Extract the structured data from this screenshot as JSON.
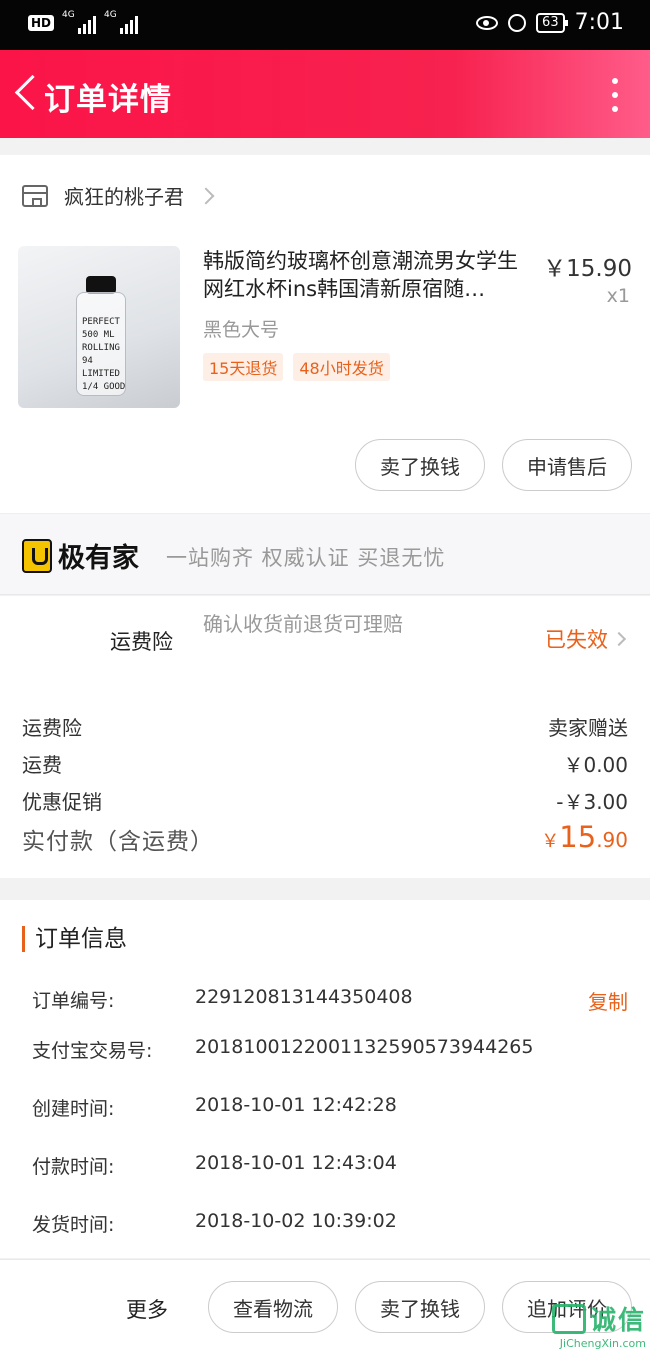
{
  "status_bar": {
    "hd_label": "HD",
    "net1": "4G",
    "net2": "4G",
    "battery": "63",
    "time": "7:01"
  },
  "nav": {
    "title": "订单详情"
  },
  "shop": {
    "name": "疯狂的桃子君"
  },
  "product": {
    "title": "韩版简约玻璃杯创意潮流男女学生网红水杯ins韩国清新原宿随…",
    "price": "￥15.90",
    "quantity": "x1",
    "spec": "黑色大号",
    "tags": [
      "15天退货",
      "48小时发货"
    ],
    "image_text": "PERFECT 500 ML ROLLING 94 LIMITED 1/4 GOOD"
  },
  "product_actions": {
    "sell_label": "卖了换钱",
    "aftersale_label": "申请售后"
  },
  "brand": {
    "name": "极有家",
    "slogan": "一站购齐 权威认证 买退无忧"
  },
  "insurance": {
    "label": "运费险",
    "description": "确认收货前退货可理赔",
    "status": "已失效"
  },
  "fees": {
    "rows": [
      {
        "label": "运费险",
        "value": "卖家赠送"
      },
      {
        "label": "运费",
        "value": "￥0.00"
      },
      {
        "label": "优惠促销",
        "value": "-￥3.00"
      }
    ],
    "total_label": "实付款（含运费）",
    "total_currency": "￥",
    "total_int": "15",
    "total_dec": ".90"
  },
  "order_info": {
    "heading": "订单信息",
    "copy_label": "复制",
    "rows": [
      {
        "label": "订单编号:",
        "value": "229120813144350408"
      },
      {
        "label": "支付宝交易号:",
        "value": "2018100122001132590573944265"
      },
      {
        "label": "创建时间:",
        "value": "2018-10-01 12:42:28"
      },
      {
        "label": "付款时间:",
        "value": "2018-10-01 12:43:04"
      },
      {
        "label": "发货时间:",
        "value": "2018-10-02 10:39:02"
      }
    ]
  },
  "bottom_bar": {
    "more_label": "更多",
    "logistics_label": "查看物流",
    "sell_label": "卖了换钱",
    "review_label": "追加评价"
  },
  "watermark": {
    "cn": "诚信",
    "en": "JiChengXin.com"
  }
}
